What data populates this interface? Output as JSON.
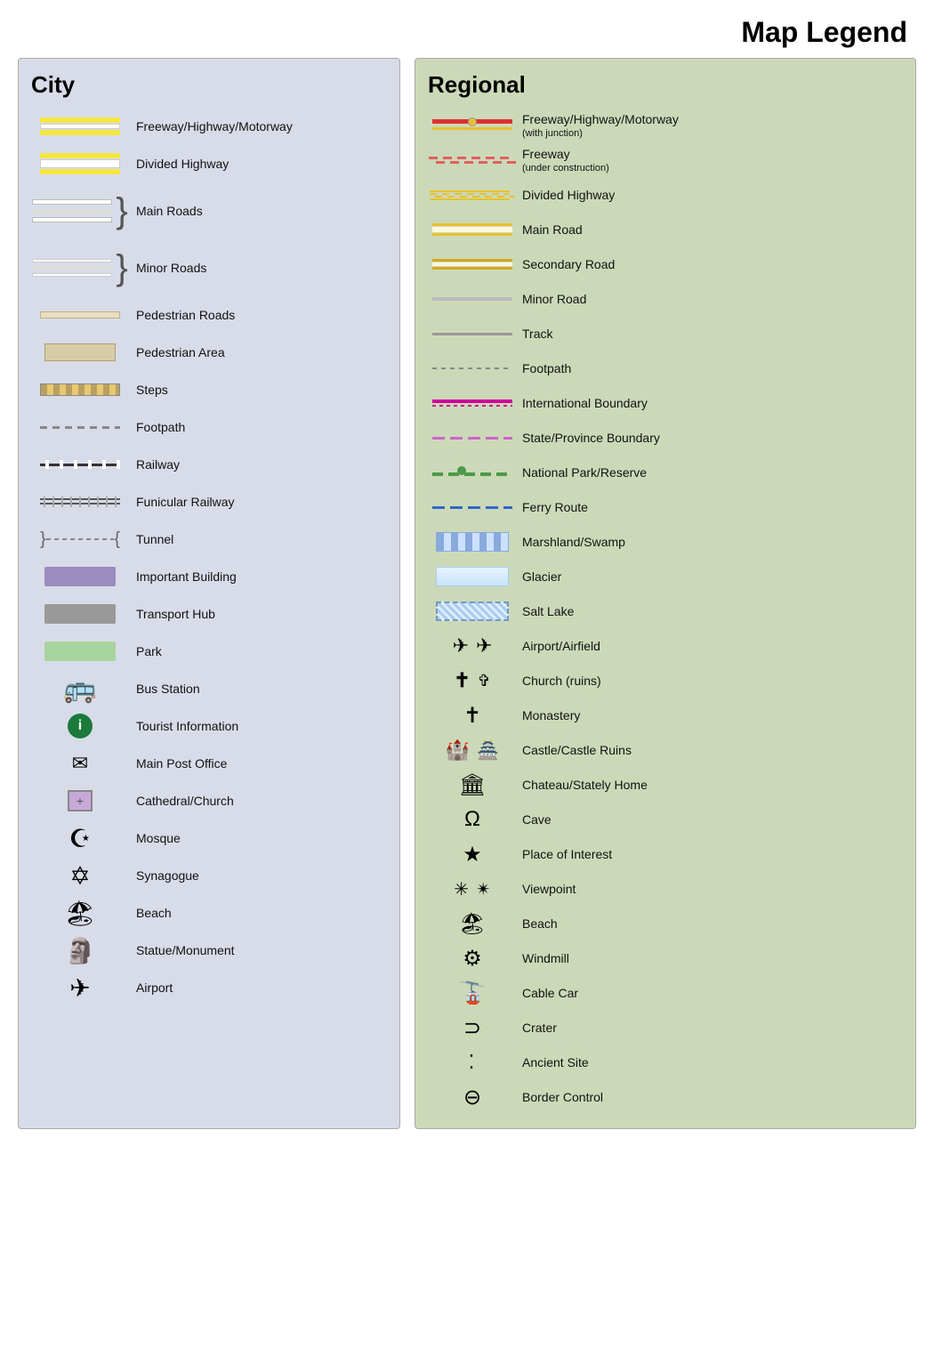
{
  "title": "Map Legend",
  "city": {
    "heading": "City",
    "items": [
      {
        "label": "Freeway/Highway/Motorway",
        "type": "freeway-city"
      },
      {
        "label": "Divided Highway",
        "type": "divided-city"
      },
      {
        "label": "Main Roads",
        "type": "main-roads"
      },
      {
        "label": "Minor Roads",
        "type": "minor-roads"
      },
      {
        "label": "Pedestrian Roads",
        "type": "pedestrian-roads"
      },
      {
        "label": "Pedestrian Area",
        "type": "pedestrian-area"
      },
      {
        "label": "Steps",
        "type": "steps"
      },
      {
        "label": "Footpath",
        "type": "footpath-city"
      },
      {
        "label": "Railway",
        "type": "railway"
      },
      {
        "label": "Funicular Railway",
        "type": "funicular"
      },
      {
        "label": "Tunnel",
        "type": "tunnel"
      },
      {
        "label": "Important Building",
        "type": "important-building"
      },
      {
        "label": "Transport Hub",
        "type": "transport-hub"
      },
      {
        "label": "Park",
        "type": "park"
      },
      {
        "label": "Bus Station",
        "type": "bus-station"
      },
      {
        "label": "Tourist Information",
        "type": "tourist-info"
      },
      {
        "label": "Main Post Office",
        "type": "main-post"
      },
      {
        "label": "Cathedral/Church",
        "type": "cathedral"
      },
      {
        "label": "Mosque",
        "type": "mosque"
      },
      {
        "label": "Synagogue",
        "type": "synagogue"
      },
      {
        "label": "Beach",
        "type": "beach-city"
      },
      {
        "label": "Statue/Monument",
        "type": "statue"
      },
      {
        "label": "Airport",
        "type": "airport-city"
      }
    ]
  },
  "regional": {
    "heading": "Regional",
    "items": [
      {
        "label": "Freeway/Highway/Motorway",
        "sublabel": "(with junction)",
        "type": "freeway-reg"
      },
      {
        "label": "Freeway",
        "sublabel": "(under construction)",
        "type": "freeway-construction"
      },
      {
        "label": "Divided Highway",
        "type": "divided-reg"
      },
      {
        "label": "Main Road",
        "type": "main-road-reg"
      },
      {
        "label": "Secondary Road",
        "type": "secondary-road"
      },
      {
        "label": "Minor Road",
        "type": "minor-road-reg"
      },
      {
        "label": "Track",
        "type": "track-reg"
      },
      {
        "label": "Footpath",
        "type": "footpath-reg"
      },
      {
        "label": "International Boundary",
        "type": "intl-boundary"
      },
      {
        "label": "State/Province Boundary",
        "type": "state-boundary"
      },
      {
        "label": "National Park/Reserve",
        "type": "natl-park"
      },
      {
        "label": "Ferry Route",
        "type": "ferry-route"
      },
      {
        "label": "Marshland/Swamp",
        "type": "marshland"
      },
      {
        "label": "Glacier",
        "type": "glacier"
      },
      {
        "label": "Salt Lake",
        "type": "salt-lake"
      },
      {
        "label": "Airport/Airfield",
        "type": "airport-reg"
      },
      {
        "label": "Church (ruins)",
        "type": "church-reg"
      },
      {
        "label": "Monastery",
        "type": "monastery"
      },
      {
        "label": "Castle/Castle Ruins",
        "type": "castle"
      },
      {
        "label": "Chateau/Stately Home",
        "type": "chateau"
      },
      {
        "label": "Cave",
        "type": "cave"
      },
      {
        "label": "Place of Interest",
        "type": "place-interest"
      },
      {
        "label": "Viewpoint",
        "type": "viewpoint"
      },
      {
        "label": "Beach",
        "type": "beach-reg"
      },
      {
        "label": "Windmill",
        "type": "windmill"
      },
      {
        "label": "Cable Car",
        "type": "cable-car"
      },
      {
        "label": "Crater",
        "type": "crater"
      },
      {
        "label": "Ancient Site",
        "type": "ancient-site"
      },
      {
        "label": "Border Control",
        "type": "border-control"
      }
    ]
  }
}
